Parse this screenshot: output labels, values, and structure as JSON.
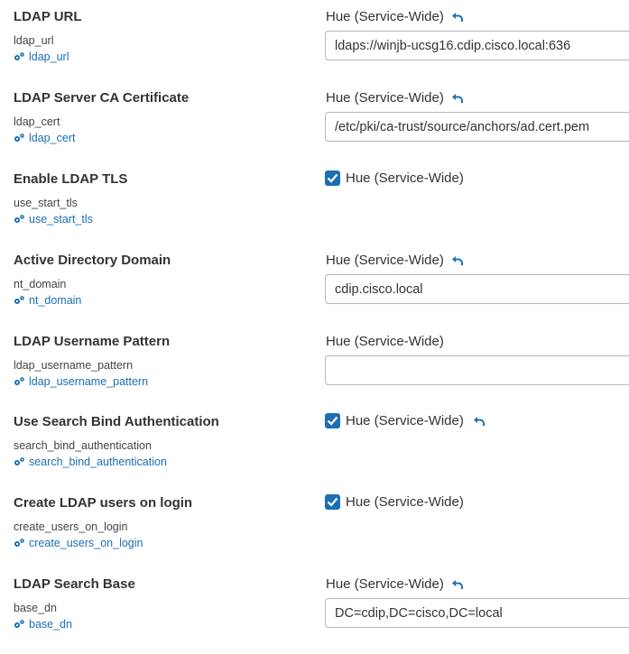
{
  "scope_label": "Hue (Service-Wide)",
  "settings": [
    {
      "label": "LDAP URL",
      "key": "ldap_url",
      "link": "ldap_url",
      "type": "text",
      "value": "ldaps://winjb-ucsg16.cdip.cisco.local:636",
      "undo": true
    },
    {
      "label": "LDAP Server CA Certificate",
      "key": "ldap_cert",
      "link": "ldap_cert",
      "type": "text",
      "value": "/etc/pki/ca-trust/source/anchors/ad.cert.pem",
      "undo": true
    },
    {
      "label": "Enable LDAP TLS",
      "key": "use_start_tls",
      "link": "use_start_tls",
      "type": "checkbox",
      "checked": true,
      "undo": false
    },
    {
      "label": "Active Directory Domain",
      "key": "nt_domain",
      "link": "nt_domain",
      "type": "text",
      "value": "cdip.cisco.local",
      "undo": true
    },
    {
      "label": "LDAP Username Pattern",
      "key": "ldap_username_pattern",
      "link": "ldap_username_pattern",
      "type": "text",
      "value": "",
      "undo": false
    },
    {
      "label": "Use Search Bind Authentication",
      "key": "search_bind_authentication",
      "link": "search_bind_authentication",
      "type": "checkbox",
      "checked": true,
      "undo": true
    },
    {
      "label": "Create LDAP users on login",
      "key": "create_users_on_login",
      "link": "create_users_on_login",
      "type": "checkbox",
      "checked": true,
      "undo": false
    },
    {
      "label": "LDAP Search Base",
      "key": "base_dn",
      "link": "base_dn",
      "type": "text",
      "value": "DC=cdip,DC=cisco,DC=local",
      "undo": true
    }
  ],
  "colors": {
    "accent": "#1a6fb5"
  },
  "icons": {
    "link": "gears-icon",
    "undo": "undo-arrow-icon",
    "check": "checkmark-icon"
  }
}
